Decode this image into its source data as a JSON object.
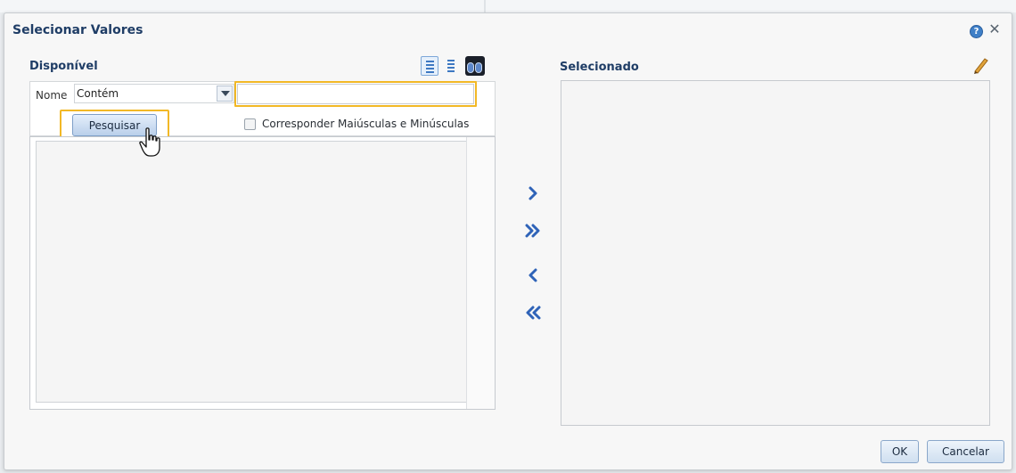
{
  "dialog": {
    "title": "Selecionar Valores",
    "help_icon": "help-icon",
    "close_glyph": "✕"
  },
  "available": {
    "label": "Disponível",
    "name_label": "Nome",
    "operator_value": "Contém",
    "search_value": "",
    "search_button": "Pesquisar",
    "match_case_label": "Corresponder Maiúsculas e Minúsculas",
    "match_case_checked": false,
    "items": []
  },
  "selected": {
    "label": "Selecionado",
    "items": []
  },
  "buttons": {
    "ok": "OK",
    "cancel": "Cancelar"
  },
  "colors": {
    "title": "#1f3d66",
    "highlight": "#f2b826",
    "arrow": "#2f63b8"
  }
}
